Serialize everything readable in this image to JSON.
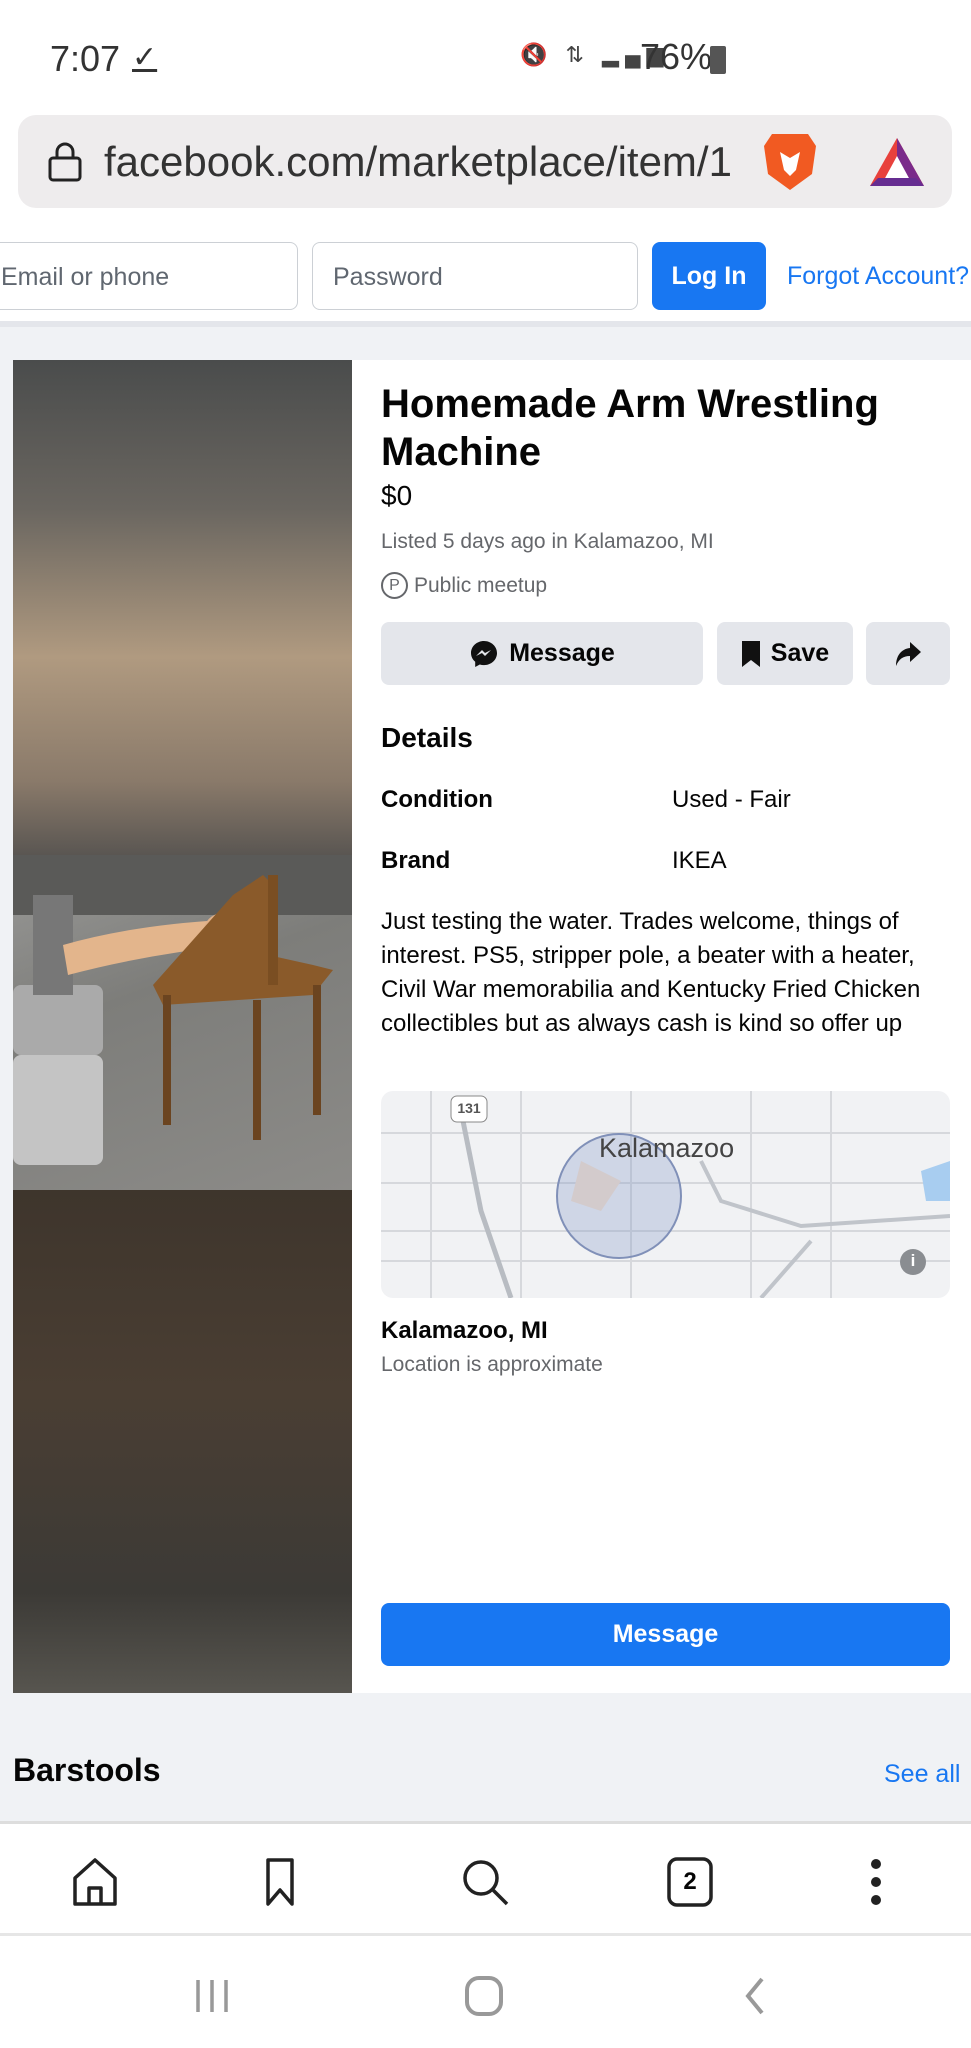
{
  "status": {
    "time": "7:07",
    "battery": "76%",
    "icons": [
      "download-done-icon",
      "mute-icon",
      "4g-lte-icon",
      "signal-icon",
      "battery-icon"
    ]
  },
  "browser": {
    "url": "facebook.com/marketplace/item/1",
    "tab_count": "2"
  },
  "login": {
    "email_placeholder": "Email or phone",
    "password_placeholder": "Password",
    "login_label": "Log In",
    "forgot_label": "Forgot Account?"
  },
  "listing": {
    "title": "Homemade Arm Wrestling Machine",
    "price": "$0",
    "listed": "Listed 5 days ago in Kalamazoo, MI",
    "meetup": "Public meetup",
    "meetup_icon_letter": "P",
    "buttons": {
      "message": "Message",
      "save": "Save"
    },
    "details_heading": "Details",
    "details": [
      {
        "key": "Condition",
        "value": "Used - Fair"
      },
      {
        "key": "Brand",
        "value": "IKEA"
      }
    ],
    "description": "Just testing the water. Trades welcome, things of interest. PS5, stripper pole, a beater with a heater, Civil War memorabilia and Kentucky Fried Chicken collectibles but as always cash is kind so offer up",
    "map": {
      "city_label": "Kalamazoo",
      "route_shield": "131"
    },
    "location": "Kalamazoo, MI",
    "location_note": "Location is approximate",
    "message_cta": "Message"
  },
  "related": {
    "heading": "Barstools",
    "see_all": "See all"
  },
  "colors": {
    "accent": "#1877f2",
    "button_gray": "#e4e6eb",
    "page_bg": "#f0f2f5"
  }
}
